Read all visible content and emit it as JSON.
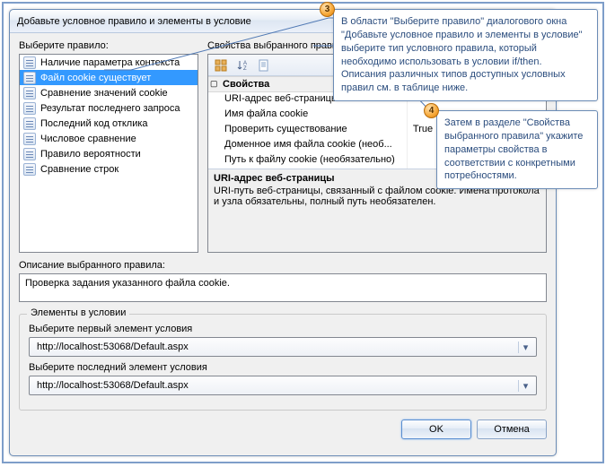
{
  "dialog": {
    "title": "Добавьте условное правило и элементы в условие",
    "help_label": "?",
    "close_label": "×"
  },
  "left": {
    "label": "Выберите правило:",
    "items": [
      "Наличие параметра контекста",
      "Файл cookie существует",
      "Сравнение значений cookie",
      "Результат последнего запроса",
      "Последний код отклика",
      "Числовое сравнение",
      "Правило вероятности",
      "Сравнение строк"
    ],
    "selected_index": 1
  },
  "right": {
    "label": "Свойства выбранного правила:",
    "category": "Свойства",
    "props": [
      {
        "name": "URI-адрес веб-страницы",
        "value": ""
      },
      {
        "name": "Имя файла cookie",
        "value": ""
      },
      {
        "name": "Проверить существование",
        "value": "True"
      },
      {
        "name": "Доменное имя файла cookie (необ...",
        "value": ""
      },
      {
        "name": "Путь к файлу cookie (необязательно)",
        "value": ""
      }
    ],
    "desc_title": "URI-адрес веб-страницы",
    "desc_text": "URI-путь веб-страницы, связанный с файлом cookie. Имена протокола и узла обязательны, полный путь необязателен."
  },
  "description": {
    "label": "Описание выбранного правила:",
    "value": "Проверка задания указанного файла cookie."
  },
  "elements": {
    "legend": "Элементы в условии",
    "first_label": "Выберите первый элемент условия",
    "first_value": "http://localhost:53068/Default.aspx",
    "last_label": "Выберите последний элемент условия",
    "last_value": "http://localhost:53068/Default.aspx"
  },
  "buttons": {
    "ok": "OK",
    "cancel": "Отмена"
  },
  "callouts": {
    "c3": "В области \"Выберите правило\" диалогового окна \"Добавьте условное правило и элементы в условие\" выберите тип условного правила, который необходимо использовать в условии if/then. Описания различных типов доступных условных правил см. в таблице ниже.",
    "c4": "Затем в разделе \"Свойства выбранного правила\" укажите параметры свойства в соответствии с конкретными потребностями.",
    "n3": "3",
    "n4": "4"
  }
}
